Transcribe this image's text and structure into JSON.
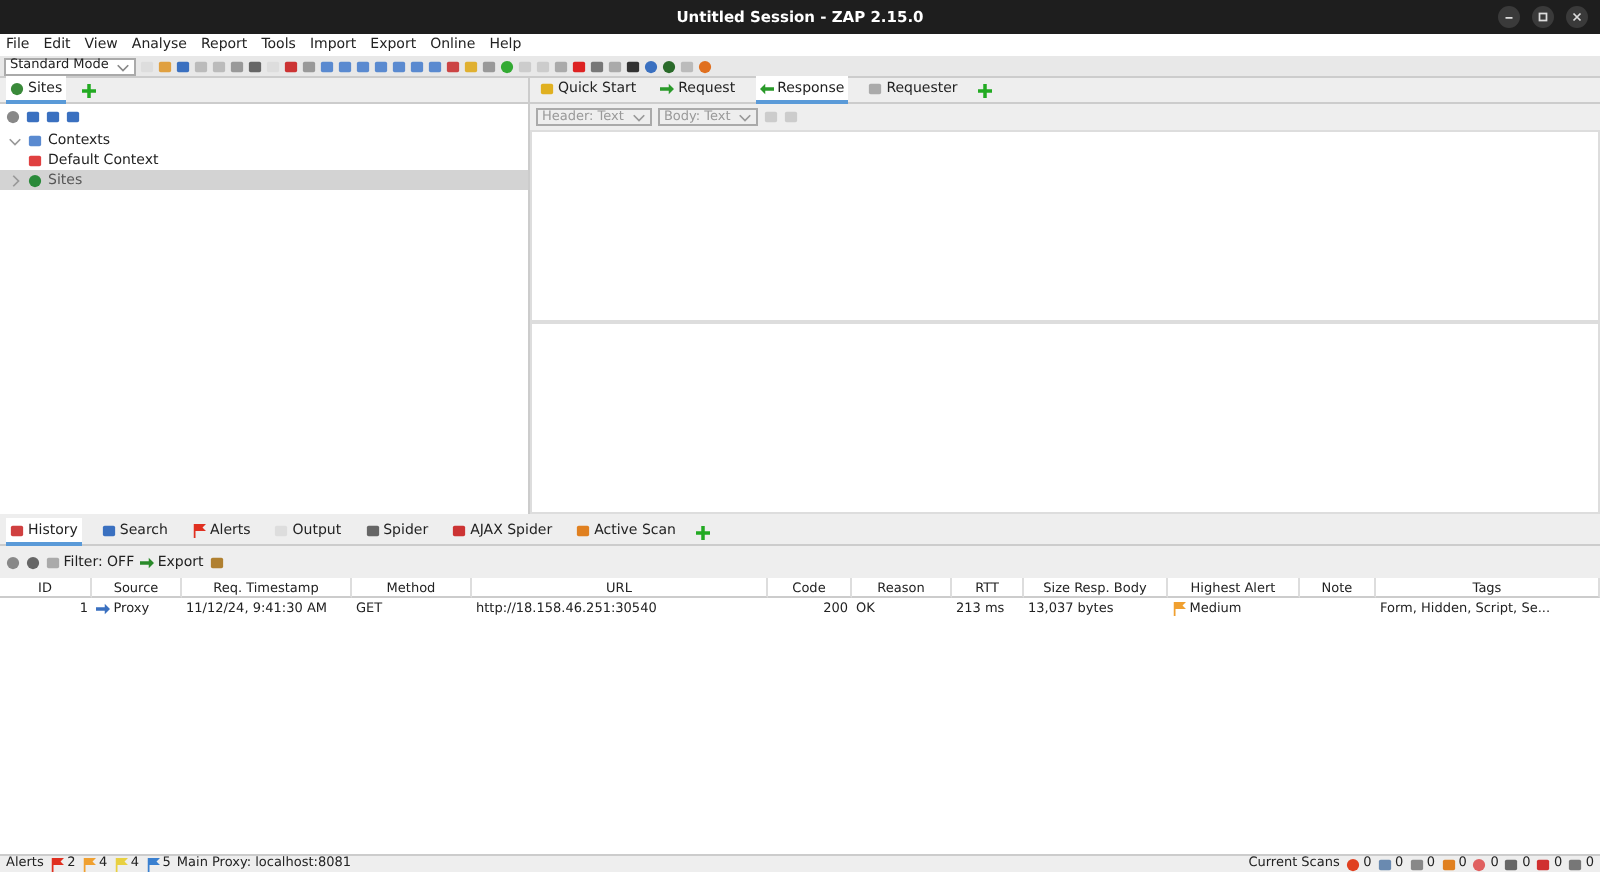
{
  "window": {
    "title": "Untitled Session - ZAP 2.15.0"
  },
  "menu": [
    "File",
    "Edit",
    "View",
    "Analyse",
    "Report",
    "Tools",
    "Import",
    "Export",
    "Online",
    "Help"
  ],
  "mode_select": {
    "value": "Standard Mode"
  },
  "sites_tabs": [
    {
      "label": "Sites",
      "selected": true
    }
  ],
  "tree": [
    {
      "label": "Contexts",
      "expanded": true,
      "selected": false,
      "children": [
        {
          "label": "Default Context",
          "selected": false
        }
      ]
    },
    {
      "label": "Sites",
      "expanded": false,
      "selected": true
    }
  ],
  "work_tabs": [
    {
      "label": "Quick Start",
      "selected": false
    },
    {
      "label": "Request",
      "selected": false
    },
    {
      "label": "Response",
      "selected": true
    },
    {
      "label": "Requester",
      "selected": false
    }
  ],
  "view_selects": [
    {
      "value": "Header: Text",
      "disabled": true
    },
    {
      "value": "Body: Text",
      "disabled": true
    }
  ],
  "bottom_tabs": [
    {
      "label": "History",
      "selected": true
    },
    {
      "label": "Search",
      "selected": false
    },
    {
      "label": "Alerts",
      "selected": false
    },
    {
      "label": "Output",
      "selected": false
    },
    {
      "label": "Spider",
      "selected": false
    },
    {
      "label": "AJAX Spider",
      "selected": false
    },
    {
      "label": "Active Scan",
      "selected": false
    }
  ],
  "history_toolbar": {
    "filter": "Filter: OFF",
    "export": "Export"
  },
  "table": {
    "columns": [
      "ID",
      "Source",
      "Req. Timestamp",
      "Method",
      "URL",
      "Code",
      "Reason",
      "RTT",
      "Size Resp. Body",
      "Highest Alert",
      "Note",
      "Tags"
    ],
    "rows": [
      {
        "id": "1",
        "source": "Proxy",
        "timestamp": "11/12/24, 9:41:30 AM",
        "method": "GET",
        "url": "http://18.158.46.251:30540",
        "code": "200",
        "reason": "OK",
        "rtt": "213 ms",
        "size": "13,037 bytes",
        "alert": "Medium",
        "color": "#f0a030",
        "tags": "Form, Hidden, Script, Se..."
      }
    ]
  },
  "status_bar": {
    "alerts_label": "Alerts",
    "alerts": [
      {
        "count": "2",
        "color": "#e03020"
      },
      {
        "count": "4",
        "color": "#f0a030"
      },
      {
        "count": "4",
        "color": "#e8d040"
      },
      {
        "count": "5",
        "color": "#3a80d0"
      }
    ],
    "proxy": "Main Proxy: localhost:8081",
    "scans_label": "Current Scans",
    "scans": [
      "0",
      "0",
      "0",
      "0",
      "0",
      "0",
      "0",
      "0"
    ]
  }
}
